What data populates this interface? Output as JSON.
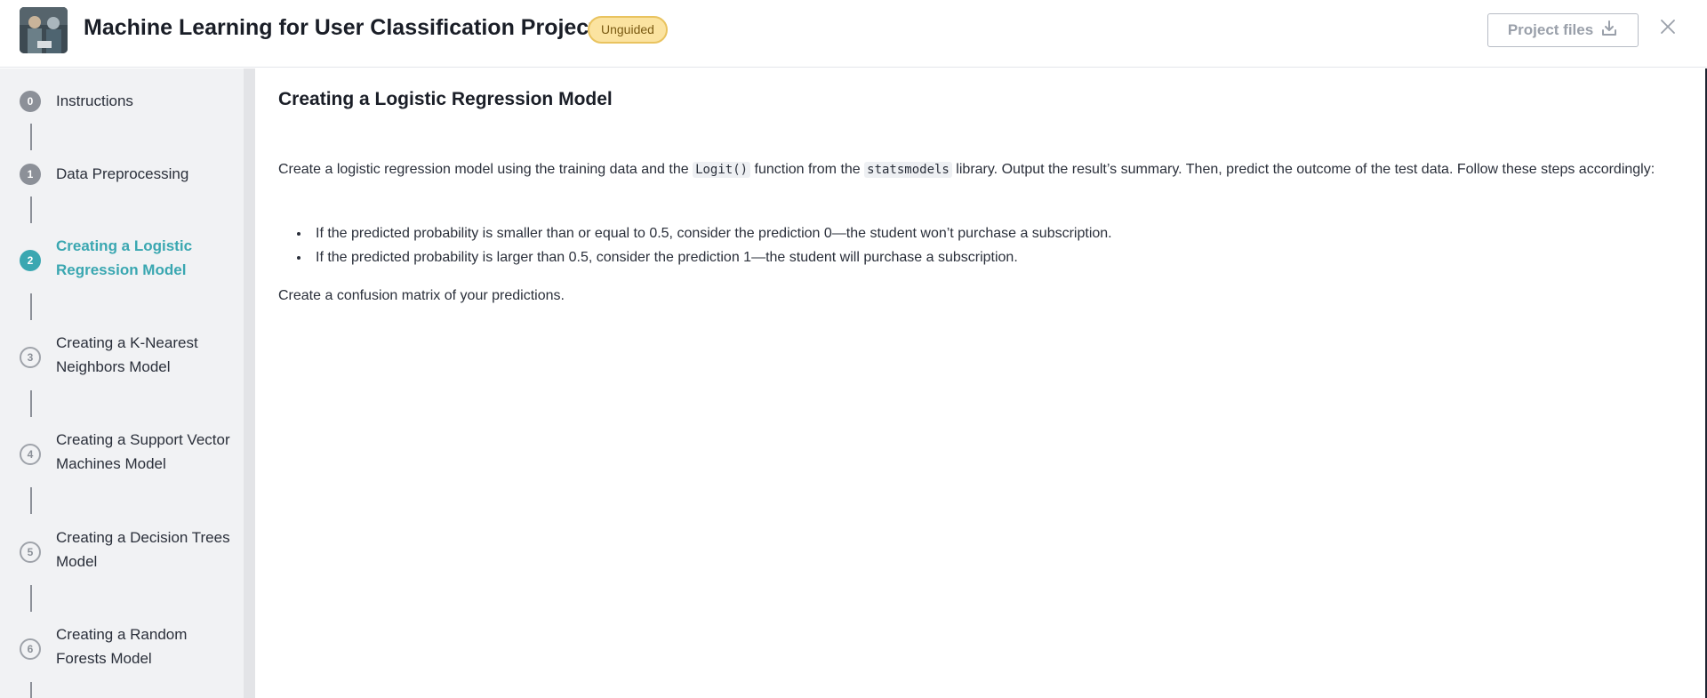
{
  "header": {
    "title": "Machine Learning for User Classification Project",
    "badge": "Unguided",
    "project_files_label": "Project files",
    "download_icon": "download-icon",
    "close_icon": "close-icon"
  },
  "sidebar": {
    "steps": [
      {
        "number": "0",
        "label": "Instructions",
        "state": "done"
      },
      {
        "number": "1",
        "label": "Data Preprocessing",
        "state": "done"
      },
      {
        "number": "2",
        "label": "Creating a Logistic Regression Model",
        "state": "active"
      },
      {
        "number": "3",
        "label": "Creating a K-Nearest Neighbors Model",
        "state": "todo"
      },
      {
        "number": "4",
        "label": "Creating a Support Vector Machines Model",
        "state": "todo"
      },
      {
        "number": "5",
        "label": "Creating a Decision Trees Model",
        "state": "todo"
      },
      {
        "number": "6",
        "label": "Creating a Random Forests Model",
        "state": "todo"
      }
    ]
  },
  "main": {
    "heading": "Creating a Logistic Regression Model",
    "paragraph": {
      "part1": "Create a logistic regression model using the training data and the ",
      "code1": "Logit()",
      "part2": " function from the ",
      "code2": "statsmodels",
      "part3": " library. Output the result’s summary. Then, predict the outcome of the test data. Follow these steps accordingly:"
    },
    "bullets": [
      "If the predicted probability is smaller than or equal to 0.5, consider the prediction 0—the student won’t purchase a subscription.",
      "If the predicted probability is larger than 0.5, consider the prediction 1—the student will purchase a subscription."
    ],
    "closing": "Create a confusion matrix of your predictions."
  },
  "colors": {
    "accent": "#3aa7b1",
    "badge_bg": "#fbe3a0",
    "badge_border": "#e9c35f"
  }
}
